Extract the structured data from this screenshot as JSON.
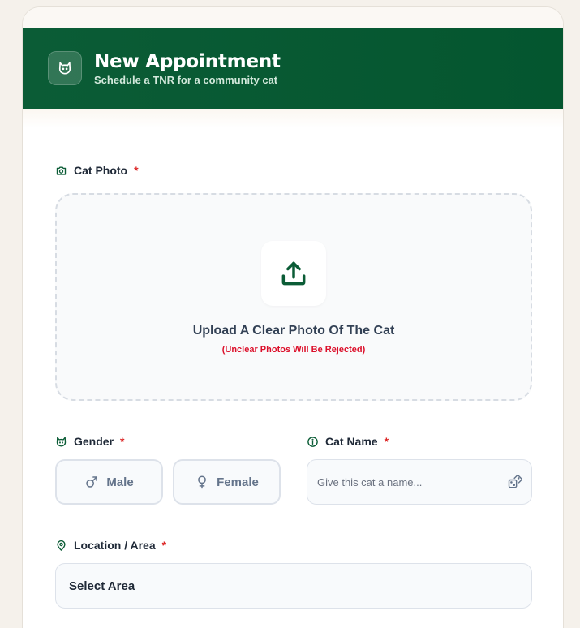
{
  "header": {
    "title": "New Appointment",
    "subtitle": "Schedule a TNR for a community cat",
    "icon": "cat-face-icon"
  },
  "form": {
    "required_marker": "*",
    "photo": {
      "label": "Cat Photo",
      "icon": "camera-icon",
      "upload_icon": "upload-icon",
      "upload_title": "Upload A Clear Photo Of The Cat",
      "upload_warning": "(Unclear Photos Will Be Rejected)"
    },
    "gender": {
      "label": "Gender",
      "icon": "cat-face-icon",
      "options": [
        {
          "label": "Male",
          "icon": "male-symbol-icon"
        },
        {
          "label": "Female",
          "icon": "female-symbol-icon"
        }
      ]
    },
    "cat_name": {
      "label": "Cat Name",
      "icon": "info-icon",
      "placeholder": "Give this cat a name...",
      "value": "",
      "random_icon": "dice-icon"
    },
    "location": {
      "label": "Location / Area",
      "icon": "map-pin-icon",
      "selected": "Select Area"
    }
  },
  "colors": {
    "brand": "#0b5c36",
    "required": "#dc2626",
    "warning": "#dc0f2a",
    "background": "#f5f1eb"
  }
}
